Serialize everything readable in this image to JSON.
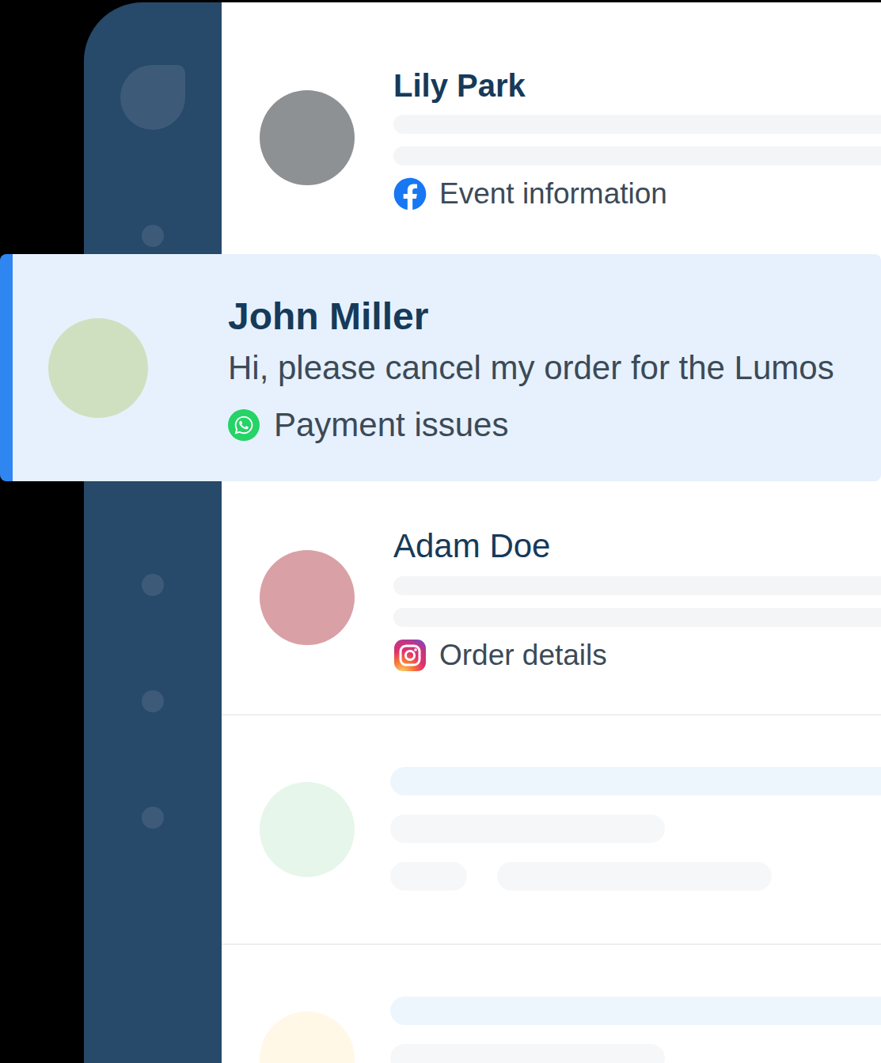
{
  "conversations": [
    {
      "name": "Lily Park",
      "channel": "facebook",
      "topic": "Event information",
      "selected": false,
      "unread": true,
      "color": "#8d9194"
    },
    {
      "name": "John Miller",
      "preview": "Hi, please cancel my order for the Lumos",
      "channel": "whatsapp",
      "topic": "Payment issues",
      "selected": true,
      "unread": true,
      "color": "#cfe0c0"
    },
    {
      "name": "Adam Doe",
      "channel": "instagram",
      "topic": "Order details",
      "selected": false,
      "unread": false,
      "color": "#d9a0a6"
    }
  ],
  "placeholders": [
    {
      "color": "#e6f6ea"
    },
    {
      "color": "#fff8e7"
    }
  ]
}
